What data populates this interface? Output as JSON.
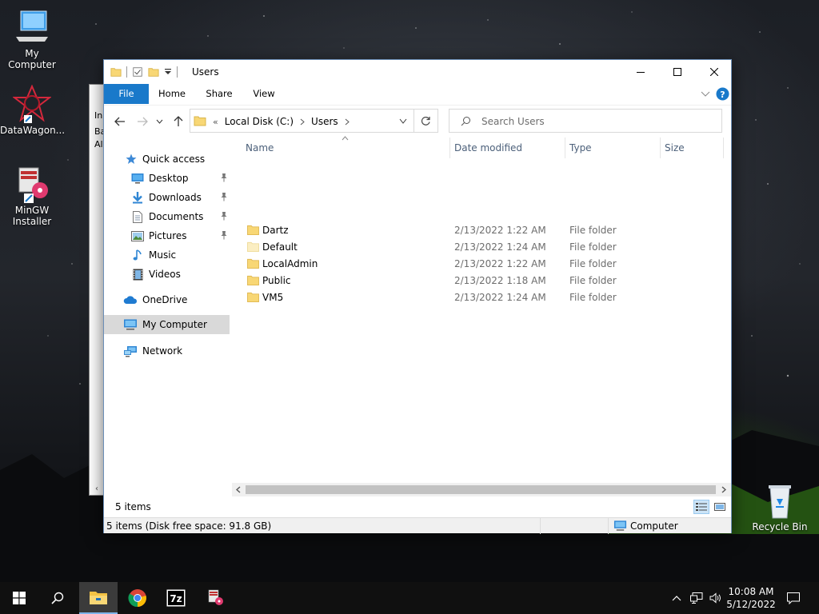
{
  "desktop": {
    "icons": [
      {
        "label": "My Computer"
      },
      {
        "label": "DataWagon..."
      },
      {
        "label": "MinGW Installer"
      },
      {
        "label": "Recycle Bin"
      }
    ],
    "back_window_rows": [
      "In",
      "Ba",
      "Al"
    ]
  },
  "explorer": {
    "title": "Users",
    "ribbon_tabs": [
      "File",
      "Home",
      "Share",
      "View"
    ],
    "address": {
      "overflow": "«",
      "crumbs": [
        "Local Disk (C:)",
        "Users"
      ]
    },
    "search": {
      "placeholder": "Search Users"
    },
    "nav": {
      "quick_access": "Quick access",
      "pinned": [
        "Desktop",
        "Downloads",
        "Documents",
        "Pictures"
      ],
      "unpinned": [
        "Music",
        "Videos"
      ],
      "onedrive": "OneDrive",
      "my_computer": "My Computer",
      "network": "Network"
    },
    "columns": [
      "Name",
      "Date modified",
      "Type",
      "Size"
    ],
    "rows": [
      {
        "name": "Dartz",
        "date": "2/13/2022 1:22 AM",
        "type": "File folder",
        "size": ""
      },
      {
        "name": "Default",
        "date": "2/13/2022 1:24 AM",
        "type": "File folder",
        "size": ""
      },
      {
        "name": "LocalAdmin",
        "date": "2/13/2022 1:22 AM",
        "type": "File folder",
        "size": ""
      },
      {
        "name": "Public",
        "date": "2/13/2022 1:18 AM",
        "type": "File folder",
        "size": ""
      },
      {
        "name": "VM5",
        "date": "2/13/2022 1:24 AM",
        "type": "File folder",
        "size": ""
      }
    ],
    "item_count": "5 items",
    "status_bar": "5 items (Disk free space: 91.8 GB)",
    "status_location": "Computer"
  },
  "taskbar": {
    "time": "10:08 AM",
    "date": "5/12/2022"
  },
  "colors": {
    "accent": "#1979ca",
    "folder": "#f8d775",
    "taskbar": "#101010"
  }
}
